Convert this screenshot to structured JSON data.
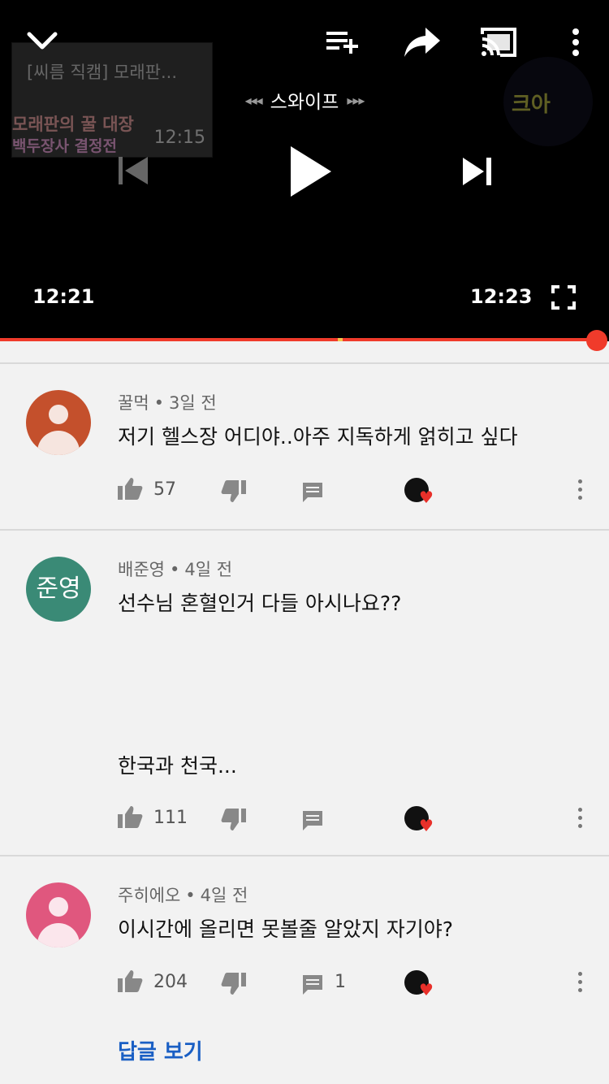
{
  "player": {
    "prev_video": {
      "title": "[씨름 직캠] 모래판...",
      "line1": "모래판의 꿀 대장",
      "line2": "백두장사 결정전",
      "duration": "12:15"
    },
    "channel_logo_text": "크아",
    "swipe_label": "스와이프",
    "swipe_left_arrows": "◂◂◂",
    "swipe_right_arrows": "▸▸▸",
    "current_time": "12:21",
    "total_time": "12:23",
    "progress_fraction": 0.98
  },
  "comments": [
    {
      "author": "꿀먹",
      "age": "3일 전",
      "text": "저기 헬스장 어디야..아주 지독하게 얽히고 싶다",
      "likes": "57",
      "replies": "",
      "avatar_color": "#c4502c",
      "avatar_initials": ""
    },
    {
      "author": "배준영",
      "age": "4일 전",
      "text": "선수님 혼혈인거 다들 아시나요??",
      "text2": "한국과 천국...",
      "likes": "111",
      "replies": "",
      "avatar_color": "#3a8a76",
      "avatar_initials": "준영"
    },
    {
      "author": "주히에오",
      "age": "4일 전",
      "text": "이시간에 올리면 못볼줄 알았지 자기야?",
      "likes": "204",
      "replies": "1",
      "avatar_color": "#e0577e",
      "avatar_initials": ""
    }
  ],
  "view_replies_label": "답글 보기",
  "meta_separator": "•",
  "colors": {
    "accent": "#f03b2b",
    "link": "#1a5fc4"
  },
  "icons": [
    "chevron-down-icon",
    "add-to-queue-icon",
    "share-icon",
    "cast-icon",
    "more-vert-icon",
    "skip-previous-icon",
    "play-icon",
    "skip-next-icon",
    "fullscreen-icon",
    "thumb-up-icon",
    "thumb-down-icon",
    "reply-icon",
    "creator-heart-icon"
  ]
}
